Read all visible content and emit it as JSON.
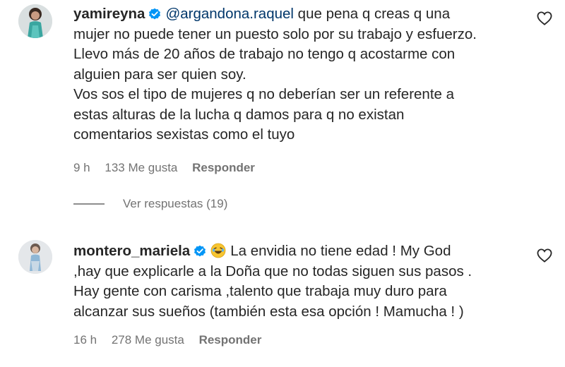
{
  "comments": [
    {
      "username": "yamireyna",
      "mention": "@argandona.raquel",
      "lines": [
        "que pena q creas q una",
        "mujer no puede tener un puesto solo por su trabajo y esfuerzo.",
        "Llevo más de 20 años de trabajo no tengo q acostarme con",
        "alguien para ser quien soy.",
        "Vos sos el tipo de mujeres q no deberían ser un referente a",
        "estas alturas de la lucha q damos para q no existan",
        "comentarios sexistas como el tuyo"
      ],
      "time": "9 h",
      "likes": "133 Me gusta",
      "reply_label": "Responder"
    },
    {
      "username": "montero_mariela",
      "lines": [
        "La envidia no tiene edad ! My God",
        ",hay que explicarle a la Doña que no todas siguen sus pasos .",
        "Hay gente con carisma ,talento que trabaja muy duro para",
        "alcanzar sus sueños (también esta esa opción ! Mamucha ! )"
      ],
      "time": "16 h",
      "likes": "278 Me gusta",
      "reply_label": "Responder"
    }
  ],
  "view_replies": "Ver respuestas (19)",
  "colors": {
    "verified": "#0095f6",
    "mention": "#00376b",
    "meta": "#737373"
  }
}
